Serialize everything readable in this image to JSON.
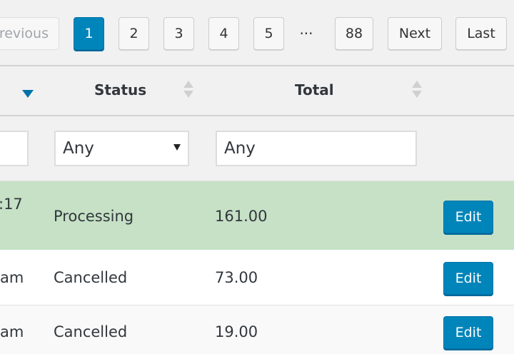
{
  "pagination": {
    "previous_label": "revious",
    "pages": [
      "1",
      "2",
      "3",
      "4",
      "5"
    ],
    "active_page": "1",
    "ellipsis": "···",
    "last_page": "88",
    "next_label": "Next",
    "last_label": "Last"
  },
  "table": {
    "columns": {
      "status": "Status",
      "total": "Total"
    },
    "filters": {
      "status_value": "Any",
      "total_value": "Any"
    },
    "rows": [
      {
        "date_fragment": ":17",
        "status": "Processing",
        "total": "161.00",
        "edit_label": "Edit"
      },
      {
        "date_fragment": "am",
        "status": "Cancelled",
        "total": "73.00",
        "edit_label": "Edit"
      },
      {
        "date_fragment": "am",
        "status": "Cancelled",
        "total": "19.00",
        "edit_label": "Edit"
      }
    ]
  },
  "colors": {
    "accent": "#0085ba",
    "processing_row": "#c6e1c6"
  }
}
